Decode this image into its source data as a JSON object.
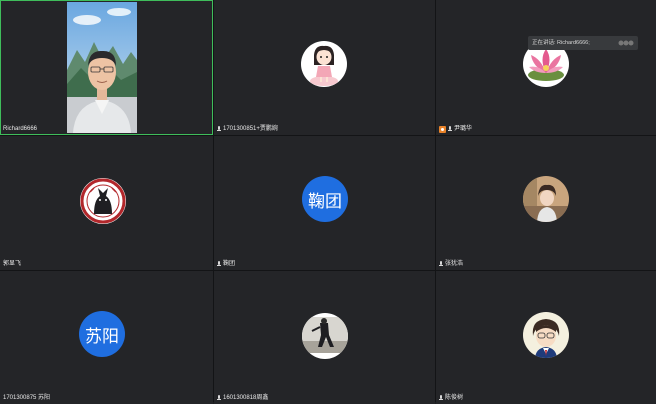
{
  "speaking": {
    "label": "正在讲话: Richard6666;"
  },
  "tiles": [
    {
      "name": "Richard6666",
      "kind": "video"
    },
    {
      "name": "1701300851+贾鹏婉",
      "kind": "image"
    },
    {
      "name": "尹璐华",
      "kind": "image"
    },
    {
      "name": "郭显飞",
      "kind": "image"
    },
    {
      "name": "鞠团",
      "kind": "text",
      "avatar_text": "鞠团"
    },
    {
      "name": "张犹浩",
      "kind": "image"
    },
    {
      "name": "1701300875 苏阳",
      "kind": "text",
      "avatar_text": "苏阳"
    },
    {
      "name": "1601300818周鑫",
      "kind": "image"
    },
    {
      "name": "陈俊树",
      "kind": "image"
    }
  ],
  "colors": {
    "active_border": "#3fbd5b",
    "text_avatar_bg": "#1f6ee0",
    "tile_bg": "#242528"
  }
}
